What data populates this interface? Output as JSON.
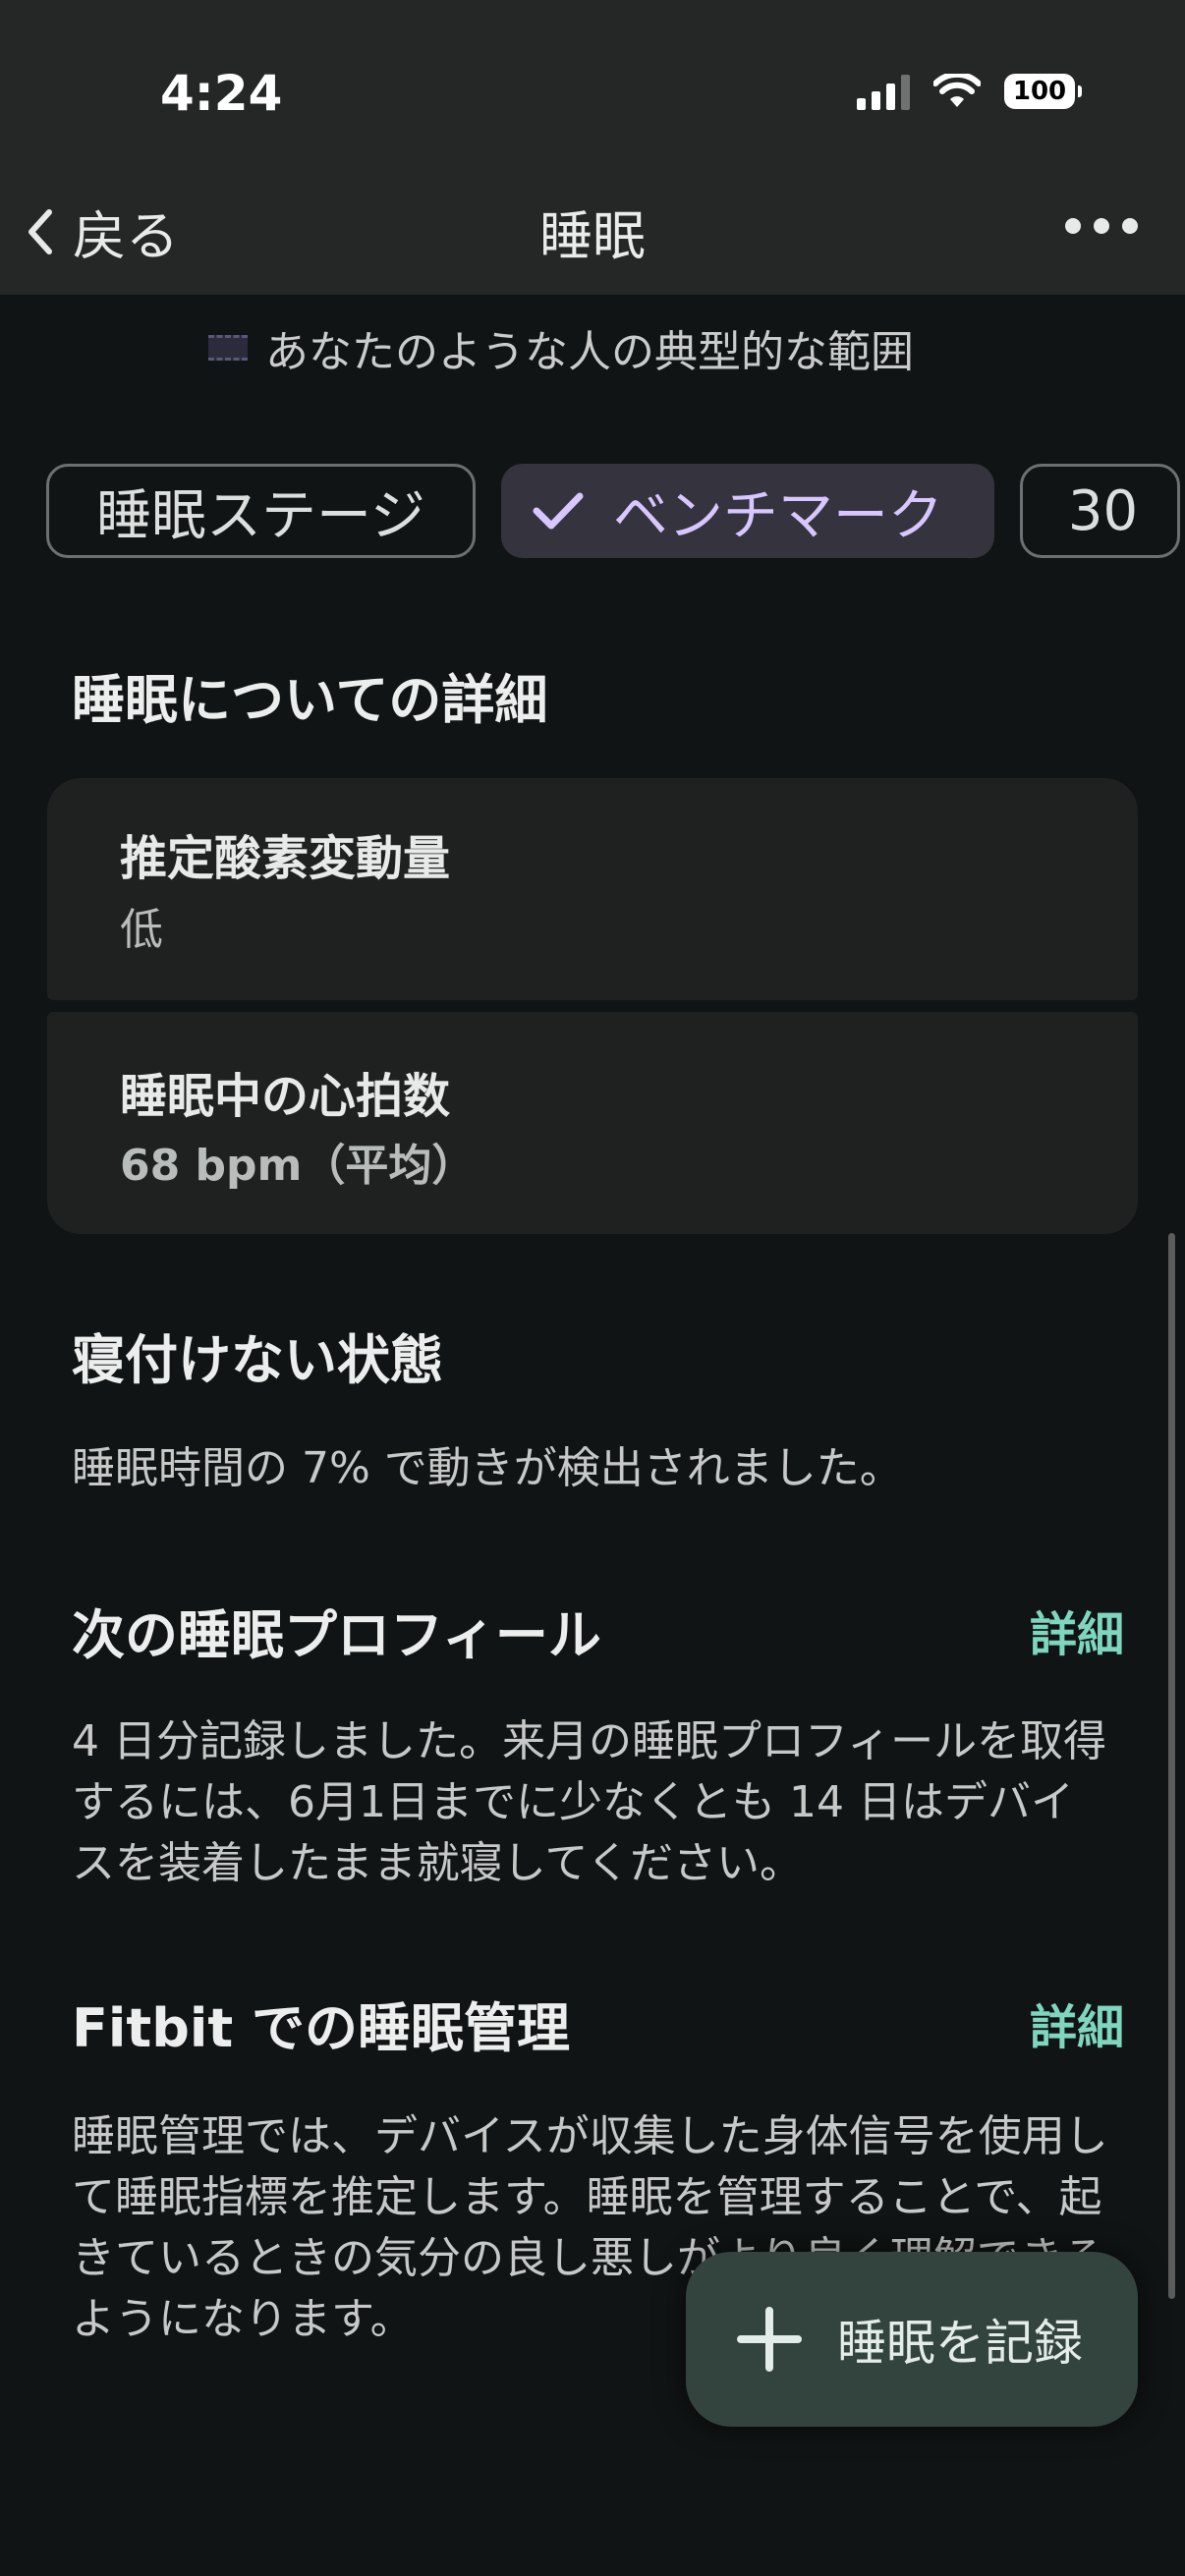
{
  "status_bar": {
    "time": "4:24",
    "battery": "100"
  },
  "nav": {
    "back_label": "戻る",
    "title": "睡眠"
  },
  "legend": {
    "text": "あなたのような人の典型的な範囲"
  },
  "chips": [
    {
      "label": "睡眠ステージ",
      "selected": false
    },
    {
      "label": "ベンチマーク",
      "selected": true
    },
    {
      "label": "30",
      "selected": false
    }
  ],
  "details": {
    "title": "睡眠についての詳細",
    "oxygen": {
      "label": "推定酸素変動量",
      "value": "低"
    },
    "heart_rate": {
      "label": "睡眠中の心拍数",
      "value": "68 bpm（平均）"
    }
  },
  "restless": {
    "title": "寝付けない状態",
    "text": "睡眠時間の 7% で動きが検出されました。"
  },
  "next_profile": {
    "title": "次の睡眠プロフィール",
    "link": "詳細",
    "text": "4 日分記録しました。来月の睡眠プロフィールを取得するには、6月1日までに少なくとも 14 日はデバイスを装着したまま就寝してください。"
  },
  "fitbit": {
    "title": "Fitbit での睡眠管理",
    "link": "詳細",
    "text": "睡眠管理では、デバイスが収集した身体信号を使用して睡眠指標を推定します。睡眠を管理することで、起きているときの気分の良し悪しがより良く理解できるようになります。"
  },
  "fab": {
    "label": "睡眠を記録"
  },
  "colors": {
    "accent": "#7fd6bf",
    "chip_selected": "#d7c6ff",
    "background": "#111414"
  }
}
